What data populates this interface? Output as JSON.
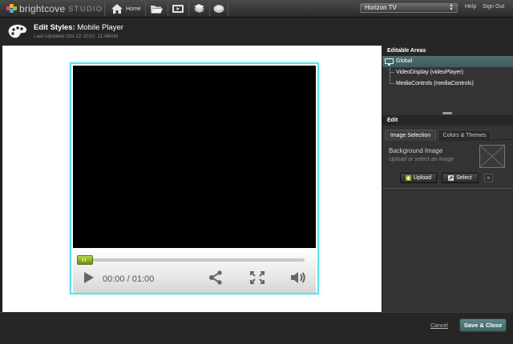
{
  "brand": {
    "name": "brightcove",
    "product": "STUDIO"
  },
  "nav": {
    "home_label": "Home",
    "items": [
      {
        "icon": "home-icon",
        "label": "Home"
      },
      {
        "icon": "folder-icon"
      },
      {
        "icon": "video-player-icon"
      },
      {
        "icon": "layers-icon"
      },
      {
        "icon": "chat-bubble-icon"
      }
    ],
    "account": "Horizon TV",
    "help": "Help",
    "sign_out": "Sign Out"
  },
  "header": {
    "title_prefix": "Edit Styles:",
    "title": "Mobile Player",
    "last_updated": "Last Updated Oct 22 2010, 11:48AM"
  },
  "player": {
    "time": "00:00 / 01:00",
    "progress": 0.0
  },
  "panel": {
    "editable_areas_title": "Editable Areas",
    "tree": [
      {
        "label": "Global",
        "selected": true
      },
      {
        "label": "VideoDisplay (videoPlayer)",
        "selected": false
      },
      {
        "label": "MediaControls (mediaControls)",
        "selected": false
      }
    ],
    "edit_title": "Edit",
    "tabs": [
      {
        "label": "Image Selection",
        "active": true
      },
      {
        "label": "Colors & Themes",
        "active": false
      }
    ],
    "background_image_label": "Background Image",
    "background_image_hint": "Upload or select an image",
    "upload_label": "Upload",
    "select_label": "Select",
    "remove_symbol": "×"
  },
  "footer": {
    "cancel": "Cancel",
    "save_close": "Save & Close"
  },
  "colors": {
    "accent": "#5fe1ec",
    "selected_row": "#4a6668",
    "save_button": "#4f7474",
    "scrubber": "#8fb22c"
  }
}
